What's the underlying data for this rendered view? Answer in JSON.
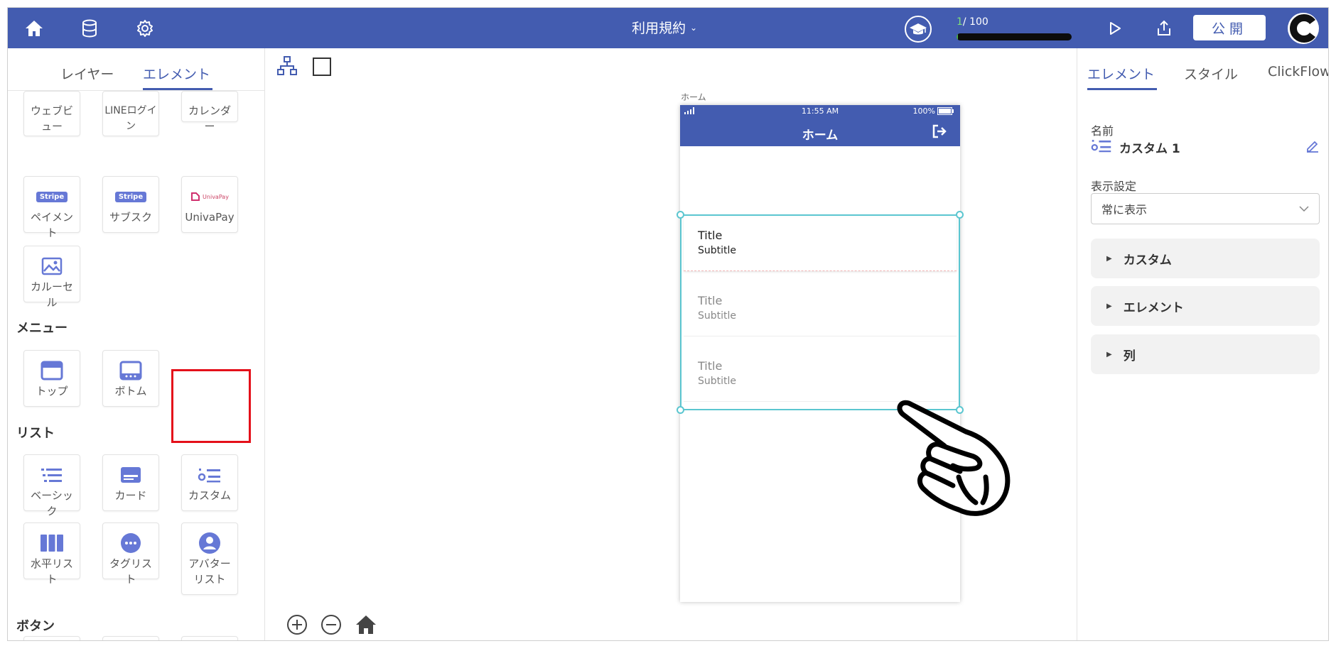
{
  "topbar": {
    "title": "利用規約",
    "progress_current": "1",
    "progress_total": "/ 100",
    "progress_fraction": 0.01,
    "publish_label": "公開",
    "accent_color": "#435cb0"
  },
  "left_panel": {
    "tabs": [
      "レイヤー",
      "エレメント"
    ],
    "active_tab": "エレメント",
    "partial_row": [
      "ウェブビュー",
      "LINEログイン",
      "カレンダー"
    ],
    "payments": [
      {
        "label": "ペイメント",
        "badge": "Stripe"
      },
      {
        "label": "サブスク",
        "badge": "Stripe"
      },
      {
        "label": "UnivaPay",
        "badge": "UnivaPay"
      }
    ],
    "carousel": "カルーセル",
    "menu_section": "メニュー",
    "menu_items": [
      "トップ",
      "ボトム"
    ],
    "list_section": "リスト",
    "list_items": [
      "ベーシック",
      "カード",
      "カスタム"
    ],
    "list_items2": [
      "水平リスト",
      "タグリスト",
      "アバターリスト"
    ],
    "button_section": "ボタン"
  },
  "canvas": {
    "page_label": "ホーム",
    "phone": {
      "time": "11:55 AM",
      "battery": "100%",
      "header_title": "ホーム"
    },
    "list_items": [
      {
        "title": "Title",
        "subtitle": "Subtitle"
      },
      {
        "title": "Title",
        "subtitle": "Subtitle"
      },
      {
        "title": "Title",
        "subtitle": "Subtitle"
      }
    ]
  },
  "right_panel": {
    "tabs": [
      "エレメント",
      "スタイル",
      "ClickFlow"
    ],
    "name_label": "名前",
    "name_value": "カスタム 1",
    "visibility_label": "表示設定",
    "visibility_value": "常に表示",
    "accordions": [
      "カスタム",
      "エレメント",
      "列"
    ]
  }
}
